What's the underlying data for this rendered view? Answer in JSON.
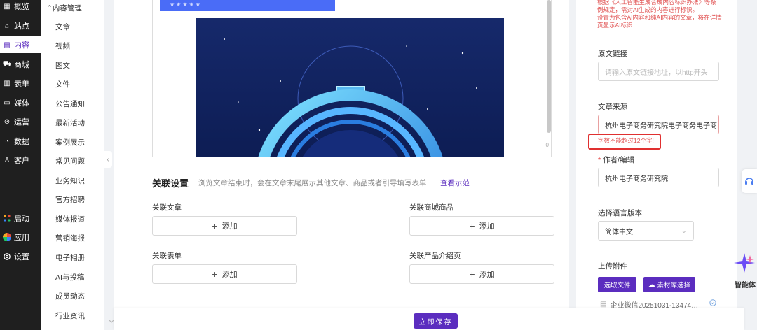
{
  "nav": {
    "items": [
      {
        "label": "概览",
        "icon": "overview-icon",
        "glyph": "▦"
      },
      {
        "label": "站点",
        "icon": "home-icon",
        "glyph": "⌂"
      },
      {
        "label": "内容",
        "icon": "document-icon",
        "glyph": "▤",
        "active": true
      },
      {
        "label": "商城",
        "icon": "cart-icon",
        "glyph": "⛟"
      },
      {
        "label": "表单",
        "icon": "form-icon",
        "glyph": "▥"
      },
      {
        "label": "媒体",
        "icon": "video-icon",
        "glyph": "▭"
      },
      {
        "label": "运营",
        "icon": "link-icon",
        "glyph": "⊘"
      },
      {
        "label": "数据",
        "icon": "chart-icon",
        "glyph": "◔"
      },
      {
        "label": "客户",
        "icon": "user-icon",
        "glyph": "♙"
      }
    ],
    "bottom": [
      {
        "label": "启动",
        "icon": "launch-icon"
      },
      {
        "label": "应用",
        "icon": "apps-icon"
      },
      {
        "label": "设置",
        "icon": "settings-icon"
      }
    ]
  },
  "submenu": {
    "group": "内容管理",
    "items": [
      "文章",
      "视频",
      "图文",
      "文件",
      "公告通知",
      "最新活动",
      "案例展示",
      "常见问题",
      "业务知识",
      "官方招聘",
      "媒体报道",
      "营销海报",
      "电子相册",
      "AI与投稿",
      "成员动态",
      "行业资讯"
    ]
  },
  "editor": {
    "banner_text": "★★★★★",
    "char_count": "0"
  },
  "relation": {
    "title": "关联设置",
    "desc": "浏览文章结束时，会在文章末尾展示其他文章、商品或者引导填写表单",
    "link": "查看示范",
    "add_label": "添加",
    "fields": [
      {
        "label": "关联文章"
      },
      {
        "label": "关联商城商品"
      },
      {
        "label": "关联表单"
      },
      {
        "label": "关联产品介绍页"
      }
    ]
  },
  "save": {
    "label": "立即保存"
  },
  "right": {
    "notice_lines": [
      "根据《人工智能生成合成内容标识办法》等条",
      "例规定，需对AI生成的内容进行标识。",
      "设置为包含AI内容和纯AI内容的文章，将在详情",
      "页显示AI标识"
    ],
    "source_link": {
      "label": "原文链接",
      "placeholder": "请输入原文链接地址，以http开头"
    },
    "article_source": {
      "label": "文章来源",
      "value": "杭州电子商务研究院电子商务电子商",
      "error": "字数不能超过12个字!"
    },
    "author": {
      "label": "作者/编辑",
      "required": "*",
      "value": "杭州电子商务研究院"
    },
    "language": {
      "label": "选择语言版本",
      "value": "简体中文"
    },
    "attachment": {
      "label": "上传附件",
      "pick_file": "选取文件",
      "library": "素材库选择",
      "file_name": "企业微信20251031-13474…"
    }
  },
  "floating": {
    "agent_label": "智能体"
  },
  "colors": {
    "brand": "#5b2dbf",
    "error": "#e03030",
    "nav_bg": "#1f1f1f"
  }
}
